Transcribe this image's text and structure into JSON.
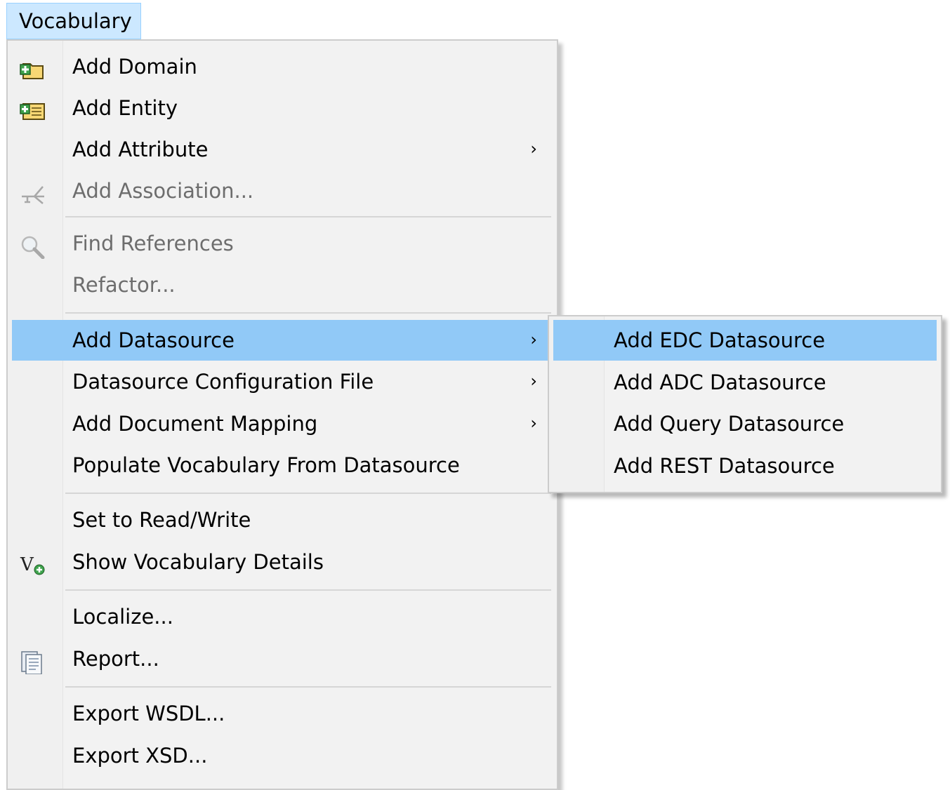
{
  "menubar": {
    "title": "Vocabulary"
  },
  "menu": {
    "add_domain": "Add Domain",
    "add_entity": "Add Entity",
    "add_attribute": "Add Attribute",
    "add_association": "Add Association...",
    "find_references": "Find References",
    "refactor": "Refactor...",
    "add_datasource": "Add Datasource",
    "datasource_config": "Datasource Configuration File",
    "add_document_mapping": "Add Document Mapping",
    "populate_vocabulary": "Populate Vocabulary From Datasource",
    "set_read_write": "Set to Read/Write",
    "show_vocabulary_details": "Show Vocabulary Details",
    "localize": "Localize...",
    "report": "Report...",
    "export_wsdl": "Export WSDL...",
    "export_xsd": "Export XSD..."
  },
  "submenu": {
    "add_edc": "Add EDC Datasource",
    "add_adc": "Add ADC Datasource",
    "add_query": "Add Query Datasource",
    "add_rest": "Add REST Datasource"
  },
  "colors": {
    "highlight": "#91c9f7",
    "menubar_active": "#cce8ff",
    "menu_background": "#f2f2f2",
    "disabled_text": "#6d6d6d"
  },
  "icons": {
    "add_domain": "folder-plus-icon",
    "add_entity": "entity-plus-icon",
    "add_association": "association-icon",
    "find_references": "magnifier-icon",
    "show_vocabulary_details": "vocabulary-v-plus-icon",
    "report": "report-document-icon",
    "submenu_arrow": "chevron-right-icon"
  }
}
